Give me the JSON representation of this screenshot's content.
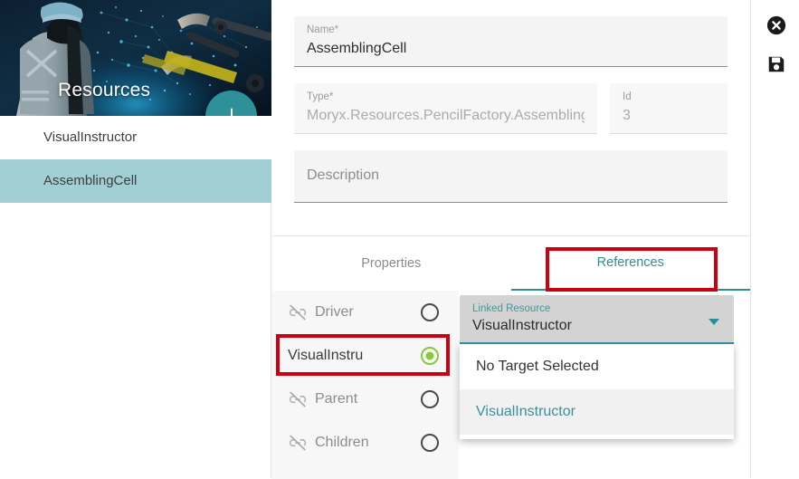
{
  "sidebar": {
    "hero_title": "Resources",
    "refresh_icon": "refresh-icon",
    "add_button_label": "+",
    "items": [
      {
        "label": "VisualInstructor",
        "selected": false
      },
      {
        "label": "AssemblingCell",
        "selected": true
      }
    ]
  },
  "form": {
    "name": {
      "label": "Name*",
      "value": "AssemblingCell"
    },
    "type": {
      "label": "Type*",
      "value": "Moryx.Resources.PencilFactory.Assembling"
    },
    "id": {
      "label": "Id",
      "value": "3"
    },
    "description": {
      "label": "",
      "placeholder": "Description",
      "value": ""
    }
  },
  "tabs": [
    {
      "label": "Properties",
      "active": false
    },
    {
      "label": "References",
      "active": true
    }
  ],
  "references": [
    {
      "label": "Driver",
      "icon": "link-off-icon",
      "linked": false,
      "selected": false
    },
    {
      "label": "VisualInstru",
      "icon": "",
      "linked": true,
      "selected": true
    },
    {
      "label": "Parent",
      "icon": "link-off-icon",
      "linked": false,
      "selected": false
    },
    {
      "label": "Children",
      "icon": "link-off-icon",
      "linked": false,
      "selected": false
    }
  ],
  "dropdown": {
    "label": "Linked Resource",
    "value": "VisualInstructor",
    "caret_icon": "chevron-down-icon",
    "options": [
      {
        "label": "No Target Selected",
        "highlighted": false
      },
      {
        "label": "VisualInstructor",
        "highlighted": true
      }
    ]
  },
  "actions": {
    "close_icon": "close-circle-icon",
    "save_icon": "save-floppy-icon"
  },
  "colors": {
    "teal": "#2d8e97",
    "teal_light": "#a2cfd4",
    "green": "#8cc63e",
    "annotation_red": "#cc0011",
    "field_gray": "#f4f4f4",
    "dropdown_gray": "#d3d3d3"
  }
}
